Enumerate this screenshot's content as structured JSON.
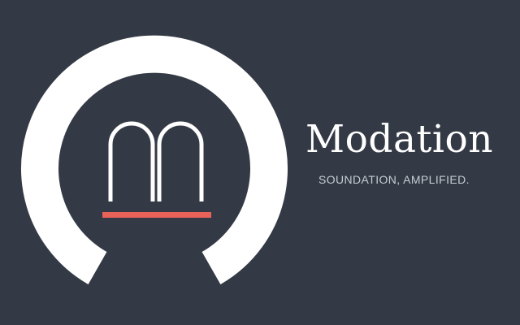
{
  "brand": {
    "name": "Modation",
    "tagline": "SOUNDATION, AMPLIFIED."
  },
  "colors": {
    "background": "#343a45",
    "ring": "#ffffff",
    "accent": "#e8625a",
    "tagline": "#c7ccd3"
  },
  "icons": {
    "logo": "ring-m-logo-icon"
  }
}
